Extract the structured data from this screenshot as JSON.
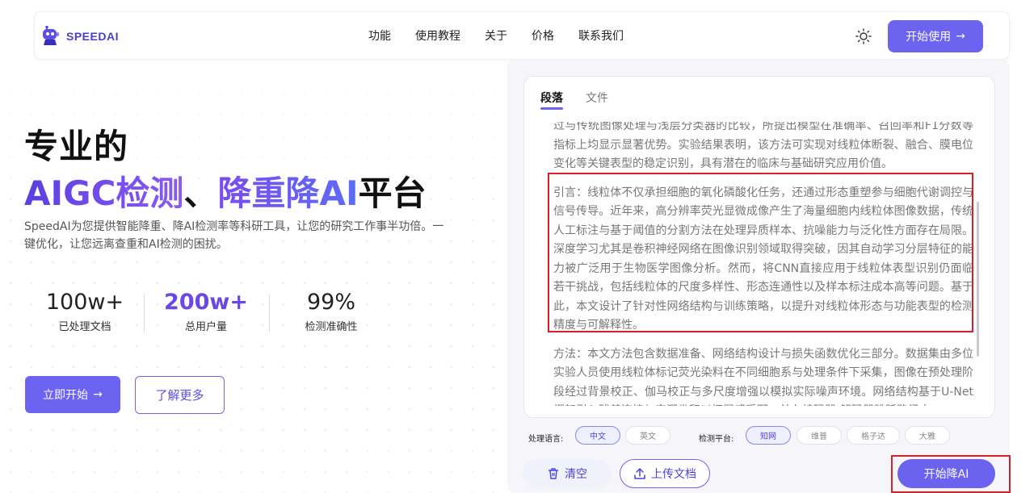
{
  "brand": {
    "name": "SPEEDAI",
    "color": "#4b3fc8"
  },
  "nav": {
    "links": [
      "功能",
      "使用教程",
      "关于",
      "价格",
      "联系我们"
    ],
    "theme_icon": "sun-icon",
    "start_label": "开始使用"
  },
  "hero": {
    "title_line1": "专业的",
    "title_part_a": "AIGC检测",
    "title_part_b": "、",
    "title_part_c": "降重降AI",
    "title_part_d": "平台",
    "description": "SpeedAI为您提供智能降重、降AI检测率等科研工具，让您的研究工作事半功倍。一键优化，让您远离查重和AI检测的困扰。",
    "stats": [
      {
        "value": "100w+",
        "label": "已处理文档"
      },
      {
        "value": "200w+",
        "label": "总用户量"
      },
      {
        "value": "99%",
        "label": "检测准确性"
      }
    ],
    "primary_button": "立即开始",
    "secondary_button": "了解更多"
  },
  "editor": {
    "tabs": [
      "段落",
      "文件"
    ],
    "active_tab": "段落",
    "paragraphs": [
      "过与传统图像处理与浅层分类器的比较，所提出模型在准确率、召回率和F1分数等指标上均显示显著优势。实验结果表明，该方法可实现对线粒体断裂、融合、膜电位变化等关键表型的稳定识别，具有潜在的临床与基础研究应用价值。",
      "引言：线粒体不仅承担细胞的氧化磷酸化任务，还通过形态重塑参与细胞代谢调控与信号传导。近年来，高分辨率荧光显微成像产生了海量细胞内线粒体图像数据，传统人工标注与基于阈值的分割方法在处理异质样本、抗噪能力与泛化性方面存在局限。深度学习尤其是卷积神经网络在图像识别领域取得突破，因其自动学习分层特征的能力被广泛用于生物医学图像分析。然而，将CNN直接应用于线粒体表型识别仍面临若干挑战，包括线粒体的尺度多样性、形态连通性以及样本标注成本高等问题。基于此，本文设计了针对性网络结构与训练策略，以提升对线粒体形态与功能表型的检测精度与可解释性。",
      "方法：本文方法包含数据准备、网络结构设计与损失函数优化三部分。数据集由多位实验人员使用线粒体标记荧光染料在不同细胞系与处理条件下采集，图像在预处理阶段经过背景校正、伽马校正与多尺度增强以模拟实际噪声环境。网络结构基于U-Net框架引入残差连接与空洞卷积以拓展感受野，并在编码器-解码器跳跃路径中"
    ],
    "language_label": "处理语言:",
    "languages": [
      "中文",
      "英文"
    ],
    "selected_language": "中文",
    "platform_label": "检测平台:",
    "platforms": [
      "知网",
      "维普",
      "格子达",
      "大雅"
    ],
    "selected_platform": "知网",
    "clear_label": "清空",
    "upload_label": "上传文档",
    "run_label": "开始降AI"
  },
  "colors": {
    "accent": "#6c63f0",
    "highlight_box": "#d8202a"
  }
}
